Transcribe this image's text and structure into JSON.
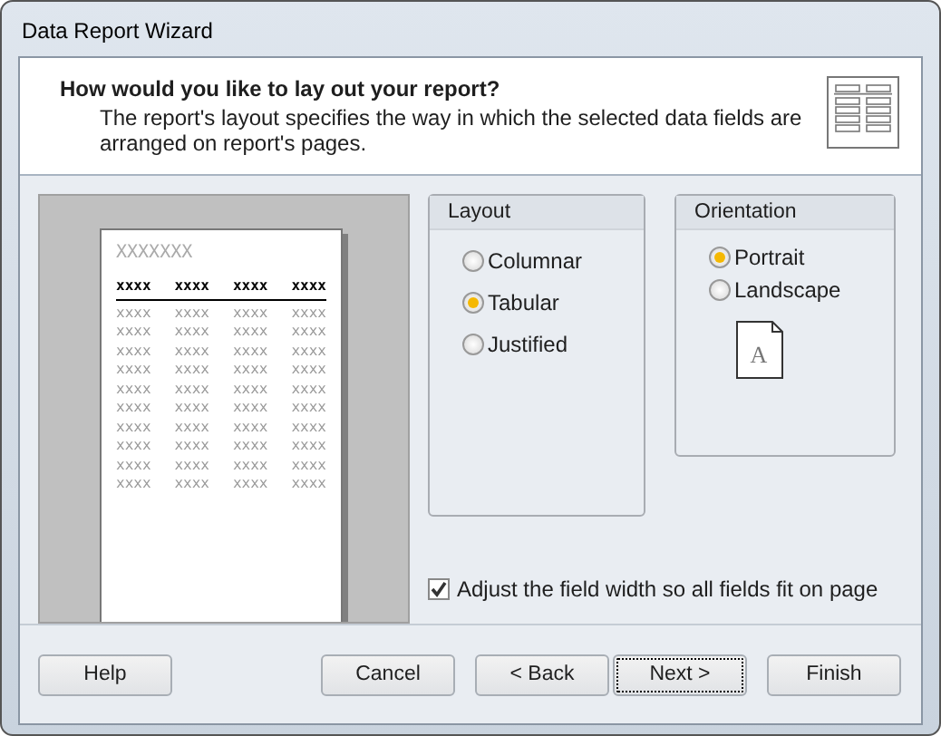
{
  "window": {
    "title": "Data Report Wizard"
  },
  "header": {
    "heading": "How would you like to lay out your report?",
    "description": "The report's layout specifies the way in which the selected data fields are arranged on report's pages."
  },
  "preview": {
    "title": "XXXXXXX",
    "header": [
      "xxxx",
      "xxxx",
      "xxxx",
      "xxxx"
    ],
    "rows": [
      [
        "xxxx",
        "xxxx",
        "xxxx",
        "xxxx"
      ],
      [
        "xxxx",
        "xxxx",
        "xxxx",
        "xxxx"
      ],
      [
        "xxxx",
        "xxxx",
        "xxxx",
        "xxxx"
      ],
      [
        "xxxx",
        "xxxx",
        "xxxx",
        "xxxx"
      ],
      [
        "xxxx",
        "xxxx",
        "xxxx",
        "xxxx"
      ],
      [
        "xxxx",
        "xxxx",
        "xxxx",
        "xxxx"
      ],
      [
        "xxxx",
        "xxxx",
        "xxxx",
        "xxxx"
      ],
      [
        "xxxx",
        "xxxx",
        "xxxx",
        "xxxx"
      ],
      [
        "xxxx",
        "xxxx",
        "xxxx",
        "xxxx"
      ],
      [
        "xxxx",
        "xxxx",
        "xxxx",
        "xxxx"
      ]
    ]
  },
  "layout": {
    "title": "Layout",
    "options": [
      {
        "label": "Columnar",
        "selected": false
      },
      {
        "label": "Tabular",
        "selected": true
      },
      {
        "label": "Justified",
        "selected": false
      }
    ]
  },
  "orientation": {
    "title": "Orientation",
    "options": [
      {
        "label": "Portrait",
        "selected": true
      },
      {
        "label": "Landscape",
        "selected": false
      }
    ],
    "icon_letter": "A"
  },
  "adjust_width": {
    "label": "Adjust the field width so all fields fit on page",
    "checked": true
  },
  "buttons": [
    {
      "label": "Help",
      "focused": false
    },
    {
      "label": "Cancel",
      "focused": false
    },
    {
      "label": "< Back",
      "focused": false
    },
    {
      "label": "Next >",
      "focused": true
    },
    {
      "label": "Finish",
      "focused": false
    }
  ]
}
